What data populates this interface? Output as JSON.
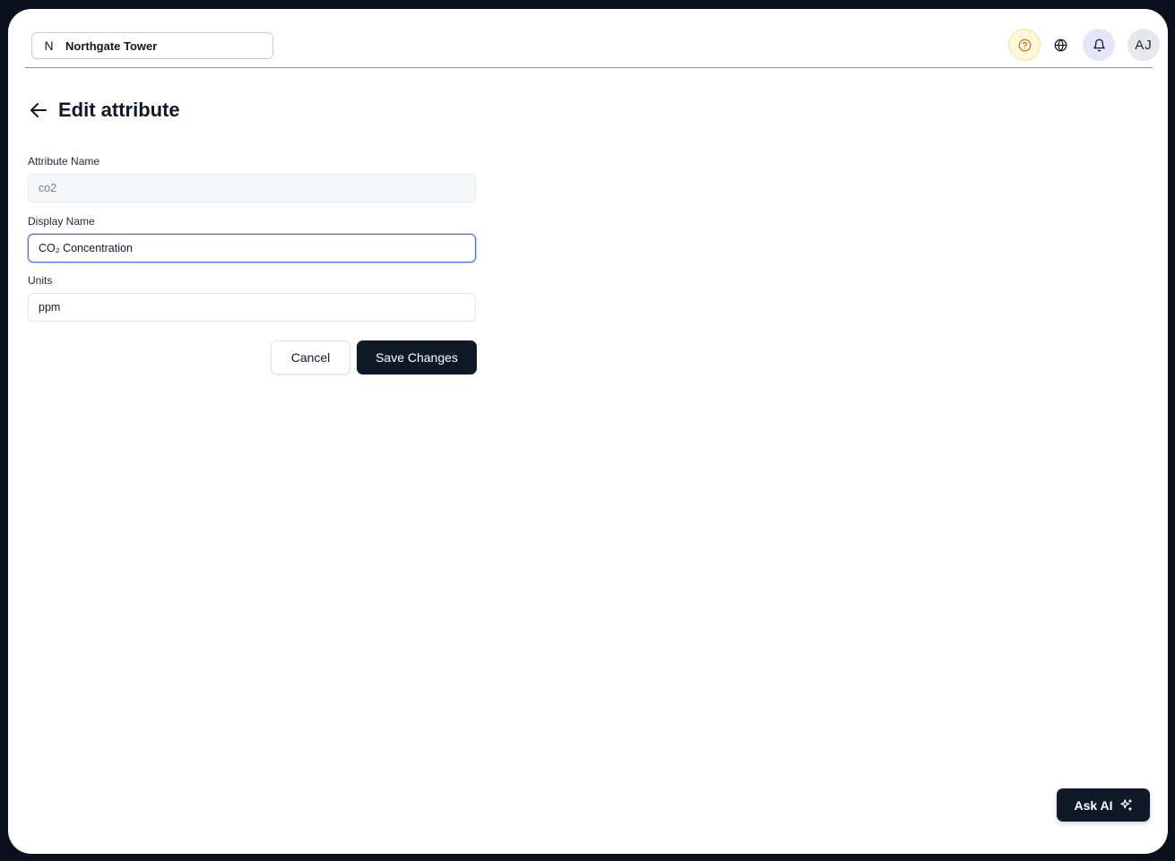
{
  "header": {
    "building_initial": "N",
    "building_name": "Northgate Tower",
    "avatar_initials": "AJ"
  },
  "page": {
    "title": "Edit attribute"
  },
  "form": {
    "attribute_name": {
      "label": "Attribute Name",
      "value": "co2",
      "disabled": true
    },
    "display_name": {
      "label": "Display Name",
      "value": "CO₂ Concentration"
    },
    "units": {
      "label": "Units",
      "value": "ppm"
    }
  },
  "actions": {
    "cancel_label": "Cancel",
    "save_label": "Save Changes"
  },
  "assistant": {
    "label": "Ask AI"
  },
  "colors": {
    "primary": "#111827",
    "help_bg": "#fdf7d9",
    "bell_bg": "#e4e5fb",
    "focus_border": "#4b6fd6"
  }
}
